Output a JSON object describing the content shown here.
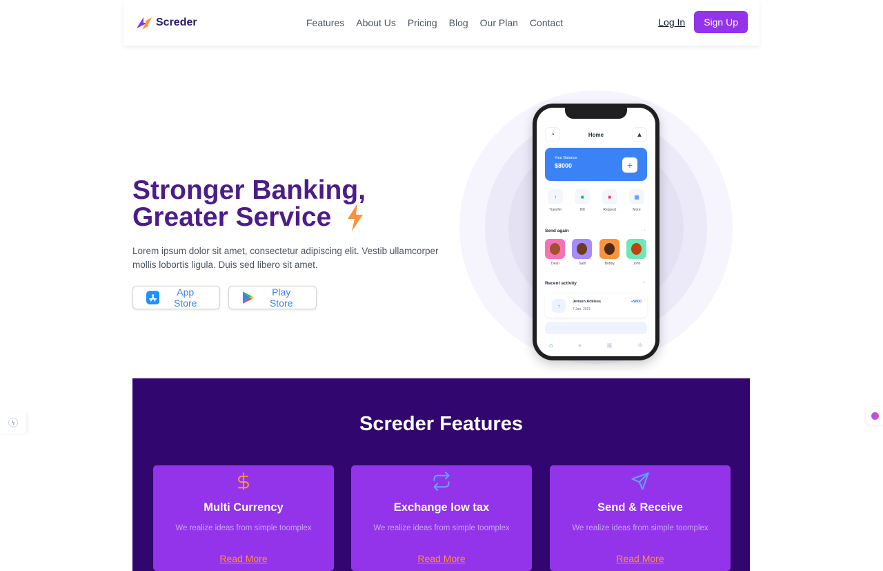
{
  "brand": {
    "name": "Screder",
    "accent": "#9333ea",
    "dark": "#32066f",
    "orange": "#fb923c"
  },
  "nav": {
    "links": [
      "Features",
      "About Us",
      "Pricing",
      "Blog",
      "Our Plan",
      "Contact"
    ],
    "login": "Log In",
    "signup": "Sign Up"
  },
  "hero": {
    "title_line1": "Stronger Banking,",
    "title_line2": "Greater Service",
    "text": "Lorem ipsum dolor sit amet, consectetur adipiscing elit. Vestib ullamcorper mollis lobortis ligula. Duis sed libero sit amet.",
    "app_store": "App Store",
    "play_store": "Play Store"
  },
  "phone": {
    "home": "Home",
    "balance_label": "Your Balance",
    "balance_value": "$8000",
    "actions": [
      "Transfer",
      "Bill",
      "Request",
      "More"
    ],
    "send_again": "Send again",
    "people": [
      "Dean",
      "Sam",
      "Bobby",
      "John"
    ],
    "recent_activity": "Recent activity",
    "activity": {
      "name": "Jensen Ackless",
      "date": "7 Jan, 2021",
      "amount": "+$800"
    }
  },
  "features": {
    "title": "Screder Features",
    "cards": [
      {
        "title": "Multi Currency",
        "text": "We realize ideas from simple toomplex",
        "link": "Read More",
        "icon": "dollar-icon"
      },
      {
        "title": "Exchange low tax",
        "text": "We realize ideas from simple toomplex",
        "link": "Read More",
        "icon": "exchange-icon"
      },
      {
        "title": "Send & Receive",
        "text": "We realize ideas from simple toomplex",
        "link": "Read More",
        "icon": "send-icon"
      }
    ]
  }
}
